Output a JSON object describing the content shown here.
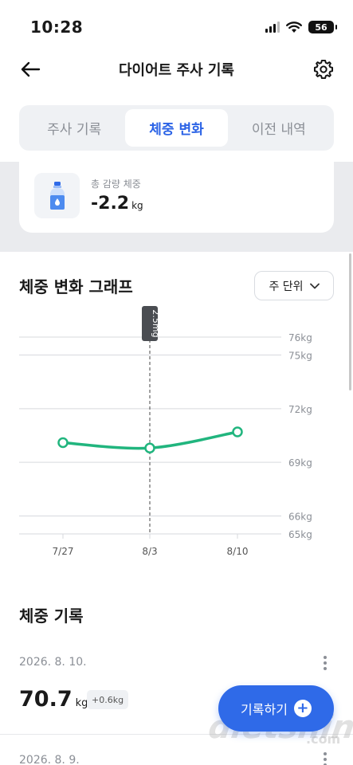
{
  "status_bar": {
    "time": "10:28",
    "battery": "56"
  },
  "header": {
    "title": "다이어트 주사 기록",
    "back_icon": "arrow-left-icon",
    "settings_icon": "gear-icon"
  },
  "tabs": [
    {
      "label": "주사 기록",
      "active": false
    },
    {
      "label": "체중 변화",
      "active": true
    },
    {
      "label": "이전 내역",
      "active": false
    }
  ],
  "summary": {
    "label": "총 감량 체중",
    "value": "-2.2",
    "unit": "kg",
    "icon": "water-bottle-icon"
  },
  "graph_section": {
    "title": "체중 변화 그래프",
    "unit_select": "주 단위"
  },
  "chart_data": {
    "type": "line",
    "x": [
      "7/27",
      "8/3",
      "8/10"
    ],
    "values": [
      70.1,
      69.8,
      70.7
    ],
    "y_tick_labels": [
      "76kg",
      "75kg",
      "72kg",
      "69kg",
      "66kg",
      "65kg"
    ],
    "y_ticks": [
      76,
      75,
      72,
      69,
      66,
      65
    ],
    "ylim": [
      65,
      76
    ],
    "marker": {
      "x": "8/3",
      "label": "2.5mg"
    },
    "line_color": "#21b57e",
    "grid": true
  },
  "records": {
    "title": "체중 기록",
    "items": [
      {
        "date": "2026. 8. 10.",
        "weight": "70.7",
        "unit": "kg",
        "diff": "+0.6kg"
      },
      {
        "date": "2026. 8. 9."
      }
    ]
  },
  "fab": {
    "label": "기록하기",
    "icon": "plus-circle-icon"
  },
  "watermark": {
    "main": "dietshin",
    "sub": ".com"
  },
  "colors": {
    "accent": "#2b63e6",
    "fab": "#2f6ae8",
    "line": "#21b57e"
  }
}
